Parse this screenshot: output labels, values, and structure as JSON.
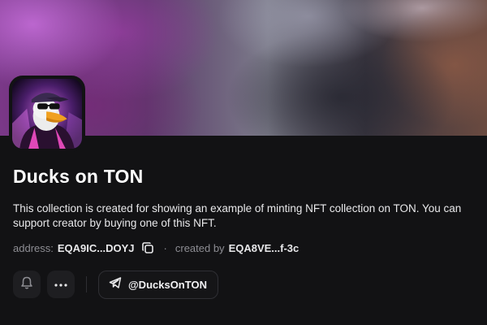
{
  "collection": {
    "title": "Ducks on TON",
    "description": "This collection is created for showing an example of minting NFT collection on TON. You can support creator by buying one of this NFT.",
    "address_label": "address:",
    "address_value": "EQA9IC...DOYJ",
    "separator": "·",
    "creator_label": "created by",
    "creator_value": "EQA8VE...f-3c"
  },
  "actions": {
    "telegram_handle": "@DucksOnTON"
  },
  "icons": {
    "avatar": "duck-avatar-image",
    "copy": "copy-icon",
    "notify": "bell-icon",
    "more": "more-dots-icon",
    "telegram": "telegram-icon"
  },
  "colors": {
    "background": "#121214",
    "text_primary": "#ffffff",
    "text_muted": "#8d8d93",
    "button_bg": "#1e1e21"
  }
}
